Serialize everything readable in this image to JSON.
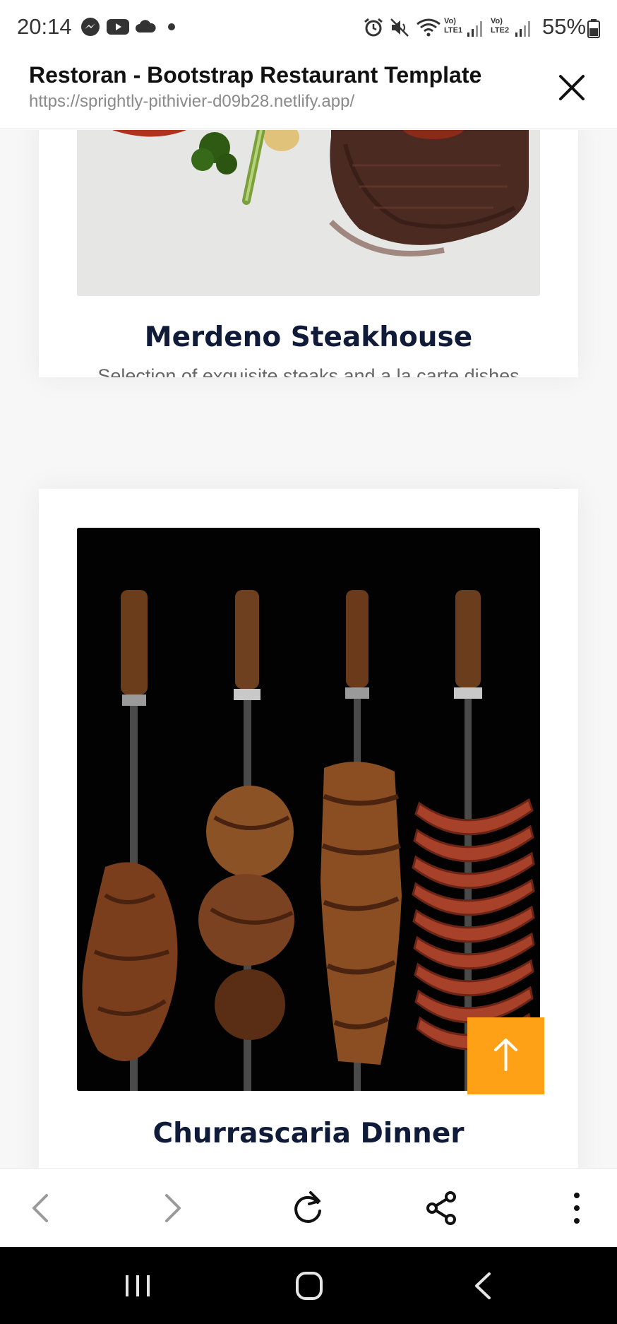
{
  "status_bar": {
    "time": "20:14",
    "left_icons": [
      "messenger-icon",
      "youtube-icon",
      "cloud-icon",
      "dot-icon"
    ],
    "right_icons": [
      "alarm-icon",
      "mute-icon",
      "wifi-icon",
      "signal-lte1-icon",
      "signal-lte2-icon",
      "battery-icon"
    ],
    "lte1_label": "Vo) LTE1",
    "lte2_label": "Vo) LTE2",
    "battery": "55%"
  },
  "tab_header": {
    "title": "Restoran - Bootstrap Restaurant Template",
    "url": "https://sprightly-pithivier-d09b28.netlify.app/"
  },
  "cards": [
    {
      "title": "Merdeno Steakhouse",
      "description": "Selection of exquisite steaks and a la carte dishes",
      "image": "grilled steak with broccoli and asparagus"
    },
    {
      "title": "Churrascaria Dinner",
      "image": "four skewers of grilled meats and sausages on black background"
    }
  ],
  "back_to_top": {
    "icon": "arrow-up-icon",
    "color": "#fea116"
  },
  "toolbar": {
    "icons": [
      "back-arrow-icon",
      "forward-arrow-icon",
      "reload-icon",
      "share-icon",
      "more-options-icon"
    ]
  },
  "navbar": {
    "icons": [
      "recent-apps-icon",
      "home-icon",
      "back-icon"
    ]
  },
  "colors": {
    "heading": "#0f1b38",
    "accent": "#fea116",
    "page_bg": "#f7f7f7"
  }
}
